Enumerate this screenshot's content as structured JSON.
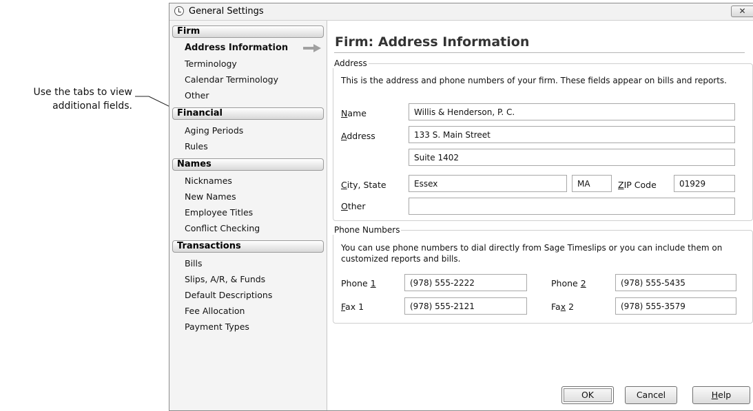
{
  "callout": {
    "line1": "Use the tabs to view",
    "line2": "additional fields."
  },
  "window": {
    "title": "General Settings",
    "close_label": "✕"
  },
  "sidebar": {
    "groups": [
      {
        "label": "Firm",
        "items": [
          "Address Information",
          "Terminology",
          "Calendar Terminology",
          "Other"
        ]
      },
      {
        "label": "Financial",
        "items": [
          "Aging Periods",
          "Rules"
        ]
      },
      {
        "label": "Names",
        "items": [
          "Nicknames",
          "New Names",
          "Employee Titles",
          "Conflict Checking"
        ]
      },
      {
        "label": "Transactions",
        "items": [
          "Bills",
          "Slips, A/R, & Funds",
          "Default Descriptions",
          "Fee Allocation",
          "Payment Types"
        ]
      }
    ],
    "active_item": "Address Information"
  },
  "page": {
    "title": "Firm: Address Information"
  },
  "address": {
    "legend": "Address",
    "description": "This is the address and phone numbers of your firm. These fields appear on bills and reports.",
    "name_label_key": "N",
    "name_label_rest": "ame",
    "name_value": "Willis & Henderson, P. C.",
    "address_label_key": "A",
    "address_label_rest": "ddress",
    "address1_value": "133 S. Main Street",
    "address2_value": "Suite 1402",
    "city_label_key": "C",
    "city_label_rest": "ity, State",
    "city_value": "Essex",
    "state_value": "MA",
    "zip_label_key": "Z",
    "zip_label_rest": "IP Code",
    "zip_value": "01929",
    "other_label_key": "O",
    "other_label_rest": "ther",
    "other_value": ""
  },
  "phones": {
    "legend": "Phone Numbers",
    "description_line1": "You can use phone numbers to dial directly from Sage Timeslips or you can include them on",
    "description_line2": "customized reports and bills.",
    "phone1_label": "Phone ",
    "phone1_key": "1",
    "phone1_value": "(978) 555-2222",
    "phone2_label": "Phone ",
    "phone2_key": "2",
    "phone2_value": "(978) 555-5435",
    "fax1_key": "F",
    "fax1_rest": "ax 1",
    "fax1_value": "(978) 555-2121",
    "fax2_pre": "Fa",
    "fax2_key": "x",
    "fax2_rest": " 2",
    "fax2_value": "(978) 555-3579"
  },
  "buttons": {
    "ok": "OK",
    "cancel": "Cancel",
    "help_key": "H",
    "help_rest": "elp"
  }
}
